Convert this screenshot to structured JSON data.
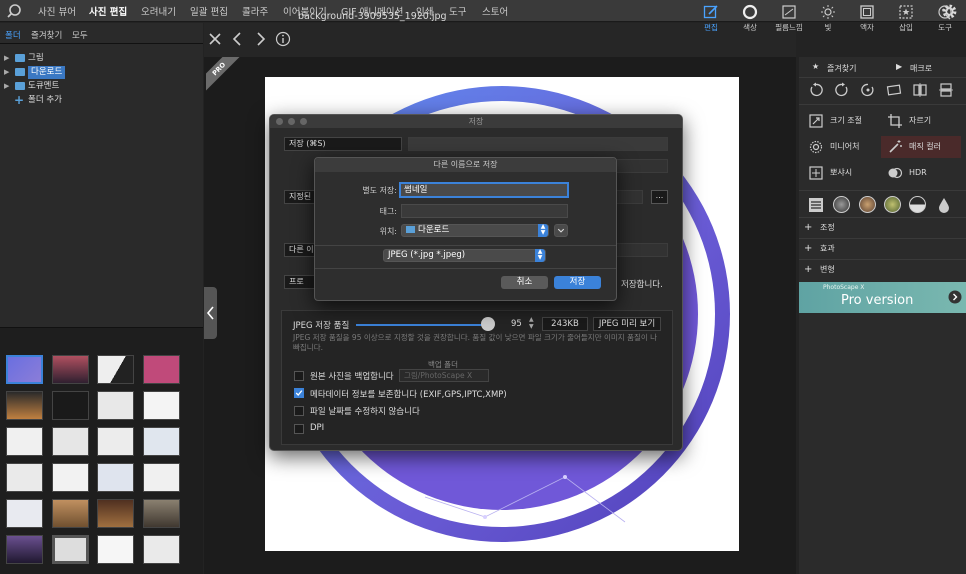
{
  "menu": [
    "사진 뷰어",
    "사진 편집",
    "오려내기",
    "일괄 편집",
    "콜라주",
    "이어붙이기",
    "GIF 애니메이션",
    "인쇄",
    "도구",
    "스토어"
  ],
  "left": {
    "tabs": [
      "폴더",
      "즐겨찾기",
      "모두"
    ],
    "tree": [
      "그림",
      "다운로드",
      "도큐멘트",
      "폴더 추가"
    ]
  },
  "center": {
    "filename": "background-3909535_1920.jpg",
    "tools": [
      "편집",
      "색상",
      "필름느낌",
      "빛",
      "액자",
      "삽입",
      "도구"
    ],
    "pro_badge": "PRO"
  },
  "right": {
    "tabs": [
      "즐겨찾기",
      "매크로"
    ],
    "buttons": [
      "크기 조절",
      "자르기",
      "미니어처",
      "매직 컬러",
      "뽀샤시",
      "HDR"
    ],
    "accordions": [
      "조정",
      "효과",
      "변형"
    ],
    "pro_banner": "Pro version",
    "pro_small": "PhotoScape X"
  },
  "save_dialog": {
    "title": "저장",
    "save_label": "저장 (⌘S)",
    "specified_prefix": "지정된",
    "other_prefix": "다른 이",
    "format_prefix": "프로",
    "note_text": "저장합니다.",
    "jpeg_quality_label": "JPEG 저장 품질",
    "quality_value": "95",
    "file_size": "243KB",
    "preview_button": "JPEG 미리 보기",
    "quality_note": "JPEG 저장 품질을 95 이상으로 지정할 것을 권장합니다. 품질 값이 낮으면 파일 크기가 줄어들지만 이미지 품질이 나빠집니다.",
    "backup_folder_label": "백업 폴더",
    "backup_folder_value": "그림/PhotoScape X",
    "checkboxes": [
      {
        "label": "원본 사진을 백업합니다",
        "checked": false
      },
      {
        "label": "메타데이터 정보를 보존합니다 (EXIF,GPS,IPTC,XMP)",
        "checked": true
      },
      {
        "label": "파일 날짜를 수정하지 않습니다",
        "checked": false
      },
      {
        "label": "DPI",
        "checked": false
      }
    ]
  },
  "save_as_dialog": {
    "title": "다른 이름으로 저장",
    "name_label": "별도 저장:",
    "name_value": "썸네일",
    "tags_label": "태그:",
    "location_label": "위치:",
    "location_value": "다운로드",
    "format_value": "JPEG (*.jpg *.jpeg)",
    "cancel": "취소",
    "save": "저장"
  },
  "colors": {
    "accent": "#3b82d9",
    "image_ring": "#6a5cd6"
  }
}
